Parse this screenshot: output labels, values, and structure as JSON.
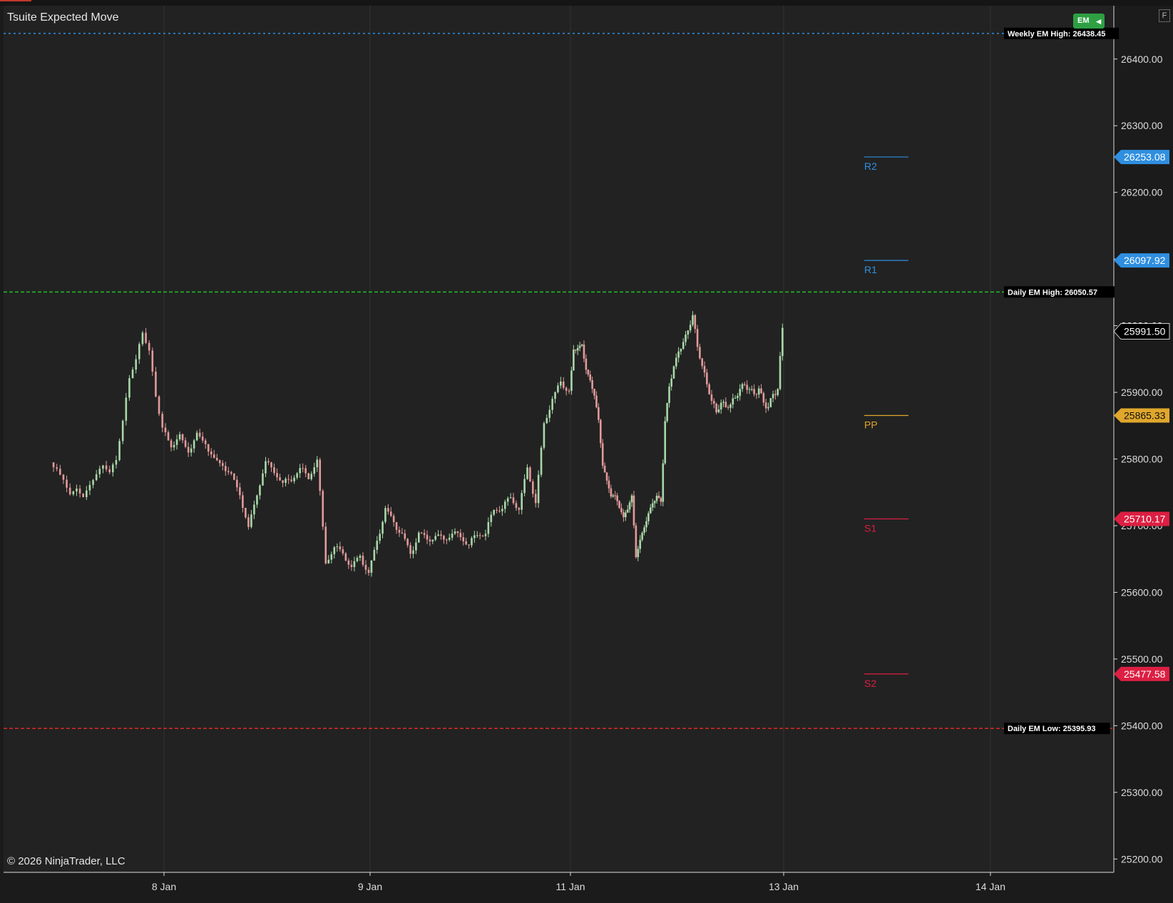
{
  "window": {
    "title": "Tsuite Expected Move",
    "copyright": "© 2026 NinjaTrader, LLC",
    "em_toggle_label": "EM",
    "corner_label": "F"
  },
  "colors": {
    "background": "#222222",
    "grid": "#333333",
    "up_candle": "#a8d8a8",
    "down_candle": "#e39a9a",
    "weekly_em": "#2f8fe0",
    "daily_em_high": "#22c02a",
    "daily_em_low": "#d92a2a",
    "resistance": "#2f8fe0",
    "pivot": "#e0a72c",
    "support": "#dc1f42"
  },
  "chart_data": {
    "type": "candlestick",
    "title": "Tsuite Expected Move",
    "ylim": [
      25180,
      26480
    ],
    "y_ticks": [
      "25200.00",
      "25300.00",
      "25400.00",
      "25500.00",
      "25600.00",
      "25700.00",
      "25800.00",
      "25900.00",
      "26000.00",
      "26100.00",
      "26200.00",
      "26300.00",
      "26400.00"
    ],
    "x_ticks": [
      "8 Jan",
      "9 Jan",
      "11 Jan",
      "13 Jan",
      "14 Jan"
    ],
    "grid": true,
    "last_price": "25991.50",
    "levels": [
      {
        "name": "Weekly EM High",
        "value": 26438.45,
        "label": "Weekly EM High: 26438.45",
        "style": "dotted"
      },
      {
        "name": "Daily EM High",
        "value": 26050.57,
        "label": "Daily EM High: 26050.57",
        "style": "dashed"
      },
      {
        "name": "Daily EM Low",
        "value": 25395.93,
        "label": "Daily EM Low: 25395.93",
        "style": "dashed"
      }
    ],
    "pivots": [
      {
        "label": "R2",
        "value": 26253.08,
        "tag": "26253.08",
        "kind": "resistance"
      },
      {
        "label": "R1",
        "value": 26097.92,
        "tag": "26097.92",
        "kind": "resistance"
      },
      {
        "label": "PP",
        "value": 25865.33,
        "tag": "25865.33",
        "kind": "pivot"
      },
      {
        "label": "S1",
        "value": 25710.17,
        "tag": "25710.17",
        "kind": "support"
      },
      {
        "label": "S2",
        "value": 25477.58,
        "tag": "25477.58",
        "kind": "support"
      }
    ],
    "series": [
      {
        "points": [
          [
            "7 Jan 07:00",
            25795
          ],
          [
            "7 Jan 08:00",
            25780
          ],
          [
            "7 Jan 09:00",
            25770
          ],
          [
            "7 Jan 10:00",
            25740
          ],
          [
            "7 Jan 11:00",
            25755
          ],
          [
            "7 Jan 12:00",
            25735
          ],
          [
            "7 Jan 13:00",
            25760
          ],
          [
            "7 Jan 14:00",
            25770
          ],
          [
            "7 Jan 15:00",
            25790
          ],
          [
            "7 Jan 16:00",
            25775
          ],
          [
            "7 Jan 17:00",
            25800
          ],
          [
            "7 Jan 18:00",
            25855
          ],
          [
            "7 Jan 19:00",
            25925
          ],
          [
            "7 Jan 20:00",
            25950
          ],
          [
            "7 Jan 21:00",
            25995
          ],
          [
            "7 Jan 22:00",
            25965
          ],
          [
            "7 Jan 23:00",
            25900
          ],
          [
            "8 Jan 00:00",
            25850
          ],
          [
            "8 Jan 01:00",
            25825
          ],
          [
            "8 Jan 02:00",
            25835
          ],
          [
            "8 Jan 03:00",
            25815
          ],
          [
            "8 Jan 04:00",
            25835
          ],
          [
            "8 Jan 05:00",
            25825
          ],
          [
            "8 Jan 06:00",
            25795
          ],
          [
            "8 Jan 07:00",
            25790
          ],
          [
            "8 Jan 08:00",
            25770
          ],
          [
            "8 Jan 09:00",
            25745
          ],
          [
            "8 Jan 10:00",
            25690
          ],
          [
            "8 Jan 11:00",
            25745
          ],
          [
            "8 Jan 12:00",
            25790
          ],
          [
            "8 Jan 13:00",
            25780
          ],
          [
            "8 Jan 14:00",
            25760
          ],
          [
            "8 Jan 15:00",
            25770
          ],
          [
            "8 Jan 16:00",
            25785
          ],
          [
            "8 Jan 17:00",
            25775
          ],
          [
            "8 Jan 18:00",
            25800
          ],
          [
            "8 Jan 19:00",
            25650
          ],
          [
            "8 Jan 20:00",
            25670
          ],
          [
            "8 Jan 21:00",
            25665
          ],
          [
            "8 Jan 22:00",
            25640
          ],
          [
            "8 Jan 23:00",
            25660
          ],
          [
            "9 Jan 00:00",
            25630
          ],
          [
            "9 Jan 01:00",
            25680
          ],
          [
            "9 Jan 02:00",
            25725
          ],
          [
            "9 Jan 03:00",
            25705
          ],
          [
            "9 Jan 04:00",
            25685
          ],
          [
            "9 Jan 05:00",
            25655
          ],
          [
            "9 Jan 06:00",
            25685
          ],
          [
            "9 Jan 07:00",
            25675
          ],
          [
            "9 Jan 08:00",
            25680
          ],
          [
            "9 Jan 09:00",
            25675
          ],
          [
            "9 Jan 10:00",
            25685
          ],
          [
            "9 Jan 11:00",
            25680
          ],
          [
            "9 Jan 12:00",
            25670
          ],
          [
            "9 Jan 13:00",
            25685
          ],
          [
            "9 Jan 14:00",
            25690
          ],
          [
            "9 Jan 15:00",
            25725
          ],
          [
            "9 Jan 16:00",
            25730
          ],
          [
            "9 Jan 17:00",
            25745
          ],
          [
            "9 Jan 18:00",
            25730
          ],
          [
            "9 Jan 19:00",
            25790
          ],
          [
            "9 Jan 20:00",
            25740
          ],
          [
            "9 Jan 21:00",
            25855
          ],
          [
            "9 Jan 22:00",
            25895
          ],
          [
            "9 Jan 23:00",
            25915
          ],
          [
            "11 Jan 00:00",
            25905
          ],
          [
            "11 Jan 01:00",
            25960
          ],
          [
            "11 Jan 02:00",
            25970
          ],
          [
            "11 Jan 03:00",
            25965
          ],
          [
            "11 Jan 04:00",
            25935
          ],
          [
            "11 Jan 05:00",
            25910
          ],
          [
            "11 Jan 06:00",
            25895
          ],
          [
            "11 Jan 07:00",
            25850
          ],
          [
            "11 Jan 08:00",
            25790
          ],
          [
            "11 Jan 09:00",
            25760
          ],
          [
            "11 Jan 10:00",
            25745
          ],
          [
            "11 Jan 11:00",
            25740
          ],
          [
            "11 Jan 12:00",
            25730
          ],
          [
            "11 Jan 13:00",
            25710
          ],
          [
            "11 Jan 14:00",
            25730
          ],
          [
            "11 Jan 15:00",
            25745
          ],
          [
            "11 Jan 16:00",
            25660
          ],
          [
            "11 Jan 17:00",
            25680
          ],
          [
            "11 Jan 18:00",
            25705
          ],
          [
            "11 Jan 19:00",
            25720
          ],
          [
            "11 Jan 20:00",
            25740
          ],
          [
            "11 Jan 21:00",
            25745
          ],
          [
            "11 Jan 22:00",
            25740
          ],
          [
            "11 Jan 23:00",
            25855
          ],
          [
            "12 Jan 00:00",
            25910
          ],
          [
            "12 Jan 01:00",
            25935
          ],
          [
            "12 Jan 02:00",
            25960
          ],
          [
            "12 Jan 03:00",
            25970
          ],
          [
            "12 Jan 04:00",
            25990
          ],
          [
            "12 Jan 05:00",
            26010
          ],
          [
            "12 Jan 06:00",
            25965
          ],
          [
            "12 Jan 07:00",
            25935
          ],
          [
            "12 Jan 08:00",
            25910
          ],
          [
            "12 Jan 09:00",
            25885
          ],
          [
            "12 Jan 10:00",
            25870
          ],
          [
            "12 Jan 11:00",
            25885
          ],
          [
            "12 Jan 12:00",
            25880
          ],
          [
            "12 Jan 13:00",
            25885
          ],
          [
            "12 Jan 14:00",
            25895
          ],
          [
            "12 Jan 15:00",
            25910
          ],
          [
            "12 Jan 16:00",
            25915
          ],
          [
            "12 Jan 17:00",
            25910
          ],
          [
            "12 Jan 18:00",
            25900
          ],
          [
            "12 Jan 19:00",
            25910
          ],
          [
            "12 Jan 20:00",
            25885
          ],
          [
            "12 Jan 21:00",
            25880
          ],
          [
            "12 Jan 22:00",
            25895
          ],
          [
            "12 Jan 23:00",
            25905
          ],
          [
            "13 Jan 00:00",
            25991.5
          ]
        ]
      }
    ]
  }
}
